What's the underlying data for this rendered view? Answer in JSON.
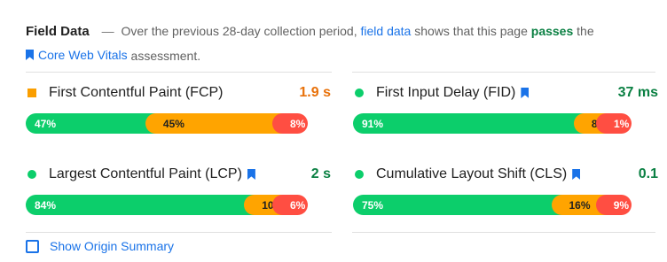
{
  "header": {
    "title": "Field Data",
    "dash": "—",
    "text_before": "Over the previous 28-day collection period,",
    "field_data_link": "field data",
    "text_middle": "shows that this page",
    "status": "passes",
    "text_the": "the",
    "cwv_link": "Core Web Vitals",
    "text_after": "assessment."
  },
  "metrics": [
    {
      "name": "First Contentful Paint (FCP)",
      "value": "1.9 s",
      "indicator": "square-orange",
      "cwv": false,
      "distribution": [
        {
          "label": "47%",
          "pct": 47
        },
        {
          "label": "45%",
          "pct": 45
        },
        {
          "label": "8%",
          "pct": 8
        }
      ]
    },
    {
      "name": "First Input Delay (FID)",
      "value": "37 ms",
      "indicator": "circle-green",
      "cwv": true,
      "distribution": [
        {
          "label": "91%",
          "pct": 91
        },
        {
          "label": "8%",
          "pct": 8
        },
        {
          "label": "1%",
          "pct": 1
        }
      ]
    },
    {
      "name": "Largest Contentful Paint (LCP)",
      "value": "2 s",
      "indicator": "circle-green",
      "cwv": true,
      "distribution": [
        {
          "label": "84%",
          "pct": 84
        },
        {
          "label": "10%",
          "pct": 10
        },
        {
          "label": "6%",
          "pct": 6
        }
      ]
    },
    {
      "name": "Cumulative Layout Shift (CLS)",
      "value": "0.1",
      "indicator": "circle-green",
      "cwv": true,
      "distribution": [
        {
          "label": "75%",
          "pct": 75
        },
        {
          "label": "16%",
          "pct": 16
        },
        {
          "label": "9%",
          "pct": 9
        }
      ]
    }
  ],
  "footer": {
    "show_origin_label": "Show Origin Summary"
  },
  "colors": {
    "fast": "#0cce6b",
    "average": "#ffa400",
    "slow": "#ff4e42",
    "link": "#1a73e8"
  }
}
